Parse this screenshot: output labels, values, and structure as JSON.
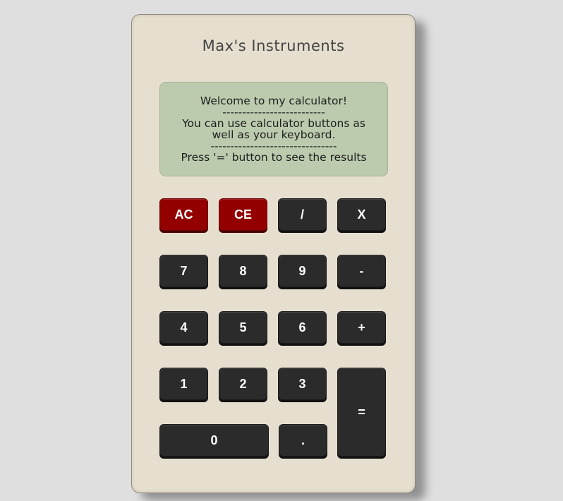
{
  "brand": {
    "title": "Max's Instruments"
  },
  "display": {
    "lines": [
      "Welcome to my calculator!",
      "--------------------------",
      "You can use calculator buttons as",
      "well as your keyboard.",
      "--------------------------------",
      "Press '=' button to see the results"
    ]
  },
  "keys": {
    "ac": "AC",
    "ce": "CE",
    "divide": "/",
    "multiply": "X",
    "seven": "7",
    "eight": "8",
    "nine": "9",
    "minus": "-",
    "four": "4",
    "five": "5",
    "six": "6",
    "plus": "+",
    "one": "1",
    "two": "2",
    "three": "3",
    "equals": "=",
    "zero": "0",
    "decimal": "."
  },
  "colors": {
    "body": "#e6dfcf",
    "screen": "#bccbae",
    "key": "#2b2b2b",
    "clear_key": "#930000",
    "background": "#dfdfdf"
  }
}
